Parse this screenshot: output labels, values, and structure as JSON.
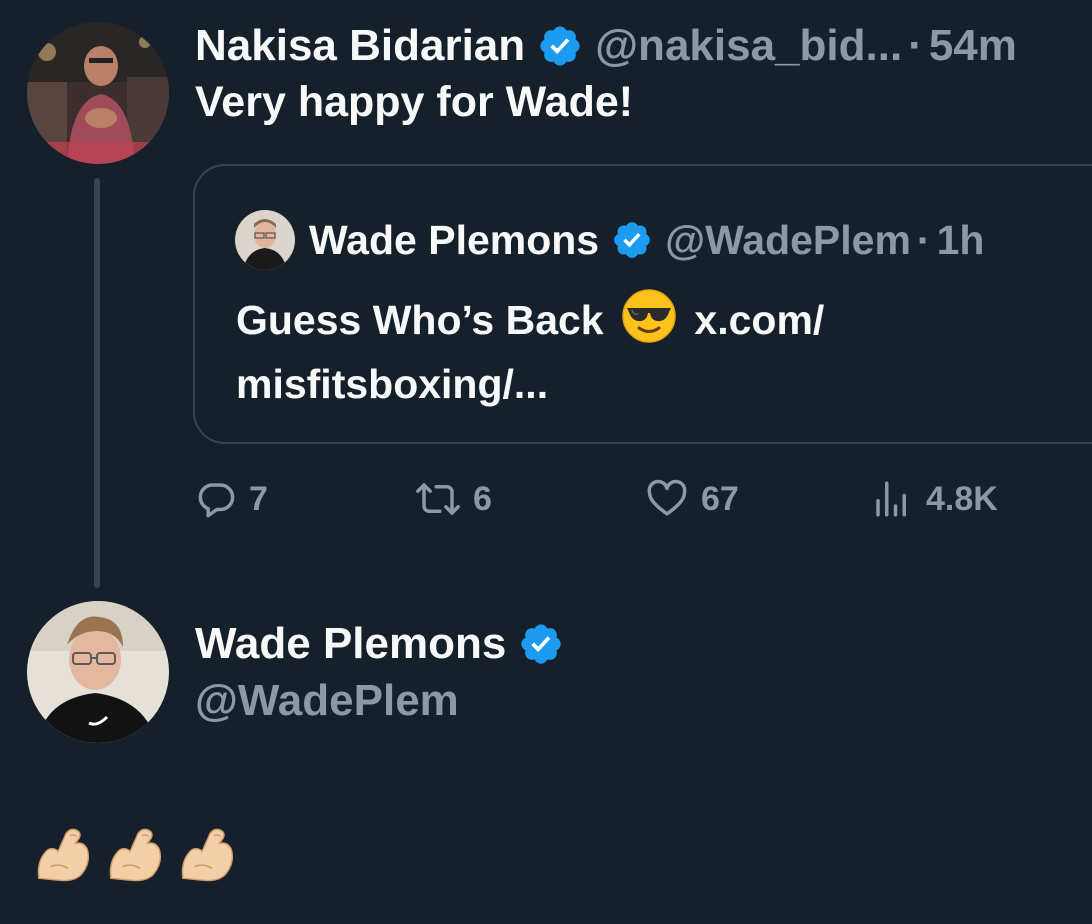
{
  "reply_tweet": {
    "display_name": "Nakisa Bidarian",
    "handle": "@nakisa_bid...",
    "separator": "·",
    "timestamp": "54m",
    "text": "Very happy for Wade!",
    "avatar_icon": "nakisa-avatar",
    "stats": {
      "replies": "7",
      "retweets": "6",
      "likes": "67",
      "views": "4.8K"
    }
  },
  "quoted_tweet": {
    "display_name": "Wade Plemons",
    "handle": "@WadePlem",
    "separator": "·",
    "timestamp": "1h",
    "text_before_emoji": "Guess Who’s Back",
    "emoji": "smiling-face-with-sunglasses",
    "text_after_emoji": "x.com/",
    "text_line2": "misfitsboxing/..."
  },
  "profile": {
    "display_name": "Wade Plemons",
    "handle": "@WadePlem"
  },
  "reply_content": {
    "emojis": [
      "flexed-biceps",
      "flexed-biceps",
      "flexed-biceps"
    ]
  },
  "colors": {
    "background": "#15202b",
    "text_primary": "#f7f9f9",
    "text_muted": "#8b98a5",
    "verified_blue": "#1d9bf0",
    "border": "#38444d"
  }
}
